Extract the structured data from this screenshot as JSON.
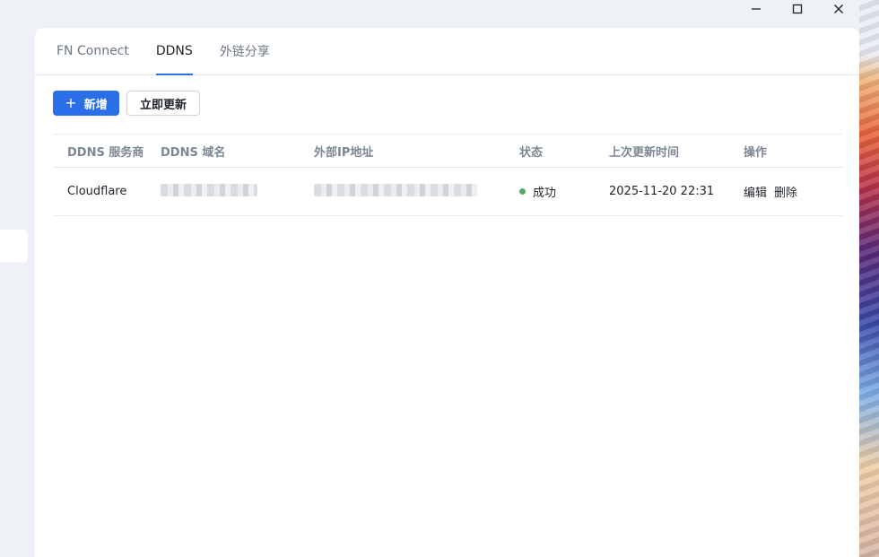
{
  "colors": {
    "accent": "#2a6ee8",
    "success": "#5aa86a"
  },
  "window": {
    "minimize_icon": "minimize-icon",
    "maximize_icon": "maximize-icon",
    "close_icon": "close-icon"
  },
  "tabs": [
    {
      "label": "FN Connect",
      "active": false
    },
    {
      "label": "DDNS",
      "active": true
    },
    {
      "label": "外链分享",
      "active": false
    }
  ],
  "toolbar": {
    "add_label": "新增",
    "add_icon": "plus-icon",
    "update_label": "立即更新"
  },
  "table": {
    "headers": [
      "DDNS 服务商",
      "DDNS 域名",
      "外部IP地址",
      "状态",
      "上次更新时间",
      "操作"
    ],
    "rows": [
      {
        "provider": "Cloudflare",
        "status": "成功",
        "updated": "2025-11-20 22:31",
        "edit_label": "编辑",
        "delete_label": "删除"
      }
    ]
  }
}
